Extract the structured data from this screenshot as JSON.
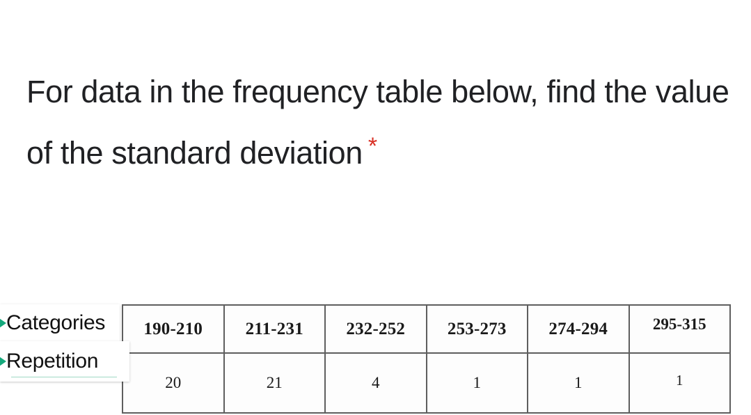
{
  "question": {
    "text": "For data in the frequency table below, find the value of the standard deviation",
    "required_marker": "*",
    "required_color": "#d93025",
    "text_color": "#202124"
  },
  "row_labels": {
    "bullet_color": "#15a97c",
    "underline_color": "#9fd8c4",
    "categories": "Categories",
    "repetition": "Repetition"
  },
  "frequency_table": {
    "border_color": "#5e5e5e",
    "header_row_name": "Categories",
    "data_row_name": "Repetition",
    "categories": [
      "190-210",
      "211-231",
      "232-252",
      "253-273",
      "274-294",
      "295-315"
    ],
    "repetitions": [
      "20",
      "21",
      "4",
      "1",
      "1",
      "1"
    ]
  },
  "chart_data": {
    "type": "table",
    "title": "For data in the frequency table below, find the value of the standard deviation",
    "xlabel": "Categories",
    "ylabel": "Repetition",
    "categories": [
      "190-210",
      "211-231",
      "232-252",
      "253-273",
      "274-294",
      "295-315"
    ],
    "values": [
      20,
      21,
      4,
      1,
      1,
      1
    ],
    "series": [
      {
        "name": "Repetition",
        "values": [
          20,
          21,
          4,
          1,
          1,
          1
        ]
      }
    ],
    "row_headers": [
      "Categories",
      "Repetition"
    ],
    "grid": true,
    "legend": "none"
  }
}
